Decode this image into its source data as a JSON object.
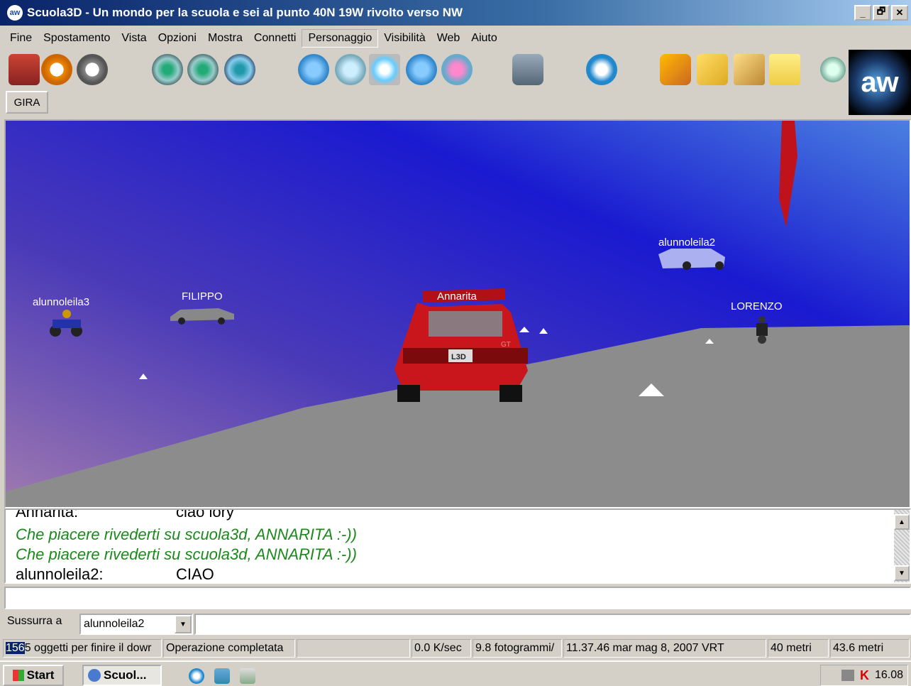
{
  "window": {
    "title": "Scuola3D - Un mondo per la scuola e sei al punto 40N 19W rivolto verso NW",
    "app_icon": "aw-globe-icon",
    "minimize": "_",
    "restore": "🗗",
    "close": "✕"
  },
  "menu": [
    "Fine",
    "Spostamento",
    "Vista",
    "Opzioni",
    "Mostra",
    "Connetti",
    "Personaggio",
    "Visibilità",
    "Web",
    "Aiuto"
  ],
  "toolbar": {
    "gira_label": "GIRA",
    "icons": [
      "home-icon",
      "back-icon",
      "forward-icon",
      "view-first-person-icon",
      "view-third-person-icon",
      "view-front-icon",
      "avatar-icon",
      "visibility-icon",
      "avatar-selected-icon",
      "group-icon",
      "contacts-icon",
      "afk-icon",
      "browser-icon",
      "teleport-icon",
      "edit-icon",
      "map-icon",
      "folder-icon",
      "scroll-down-icon"
    ],
    "logo": "aw"
  },
  "scene": {
    "labels": [
      "alunnoleila3",
      "FILIPPO",
      "Annarita",
      "alunnoleila2",
      "LORENZO"
    ],
    "plate": "L3D",
    "badge": "GT"
  },
  "chat": {
    "lines": [
      {
        "who": "Annarita:",
        "text": "ciao lory",
        "style": "normal"
      },
      {
        "who": "",
        "text": "Che piacere rivederti su scuola3d, ANNARITA :-))",
        "style": "green"
      },
      {
        "who": "",
        "text": "Che piacere rivederti su scuola3d, ANNARITA :-))",
        "style": "green"
      },
      {
        "who": "alunnoleila2:",
        "text": "CIAO",
        "style": "normal"
      }
    ]
  },
  "whisper": {
    "label": "Sussurra a",
    "target": "alunnoleila2"
  },
  "status": {
    "objects_num": "156",
    "objects_rest": "5 oggetti per finire il dowr",
    "operation": "Operazione completata",
    "speed": "0.0 K/sec",
    "fps": "9.8 fotogrammi/",
    "datetime": "11.37.46 mar mag 8, 2007 VRT",
    "dist1": "40 metri",
    "dist2": "43.6 metri"
  },
  "taskbar": {
    "start": "Start",
    "task": "Scuol...",
    "clock": "16.08"
  }
}
